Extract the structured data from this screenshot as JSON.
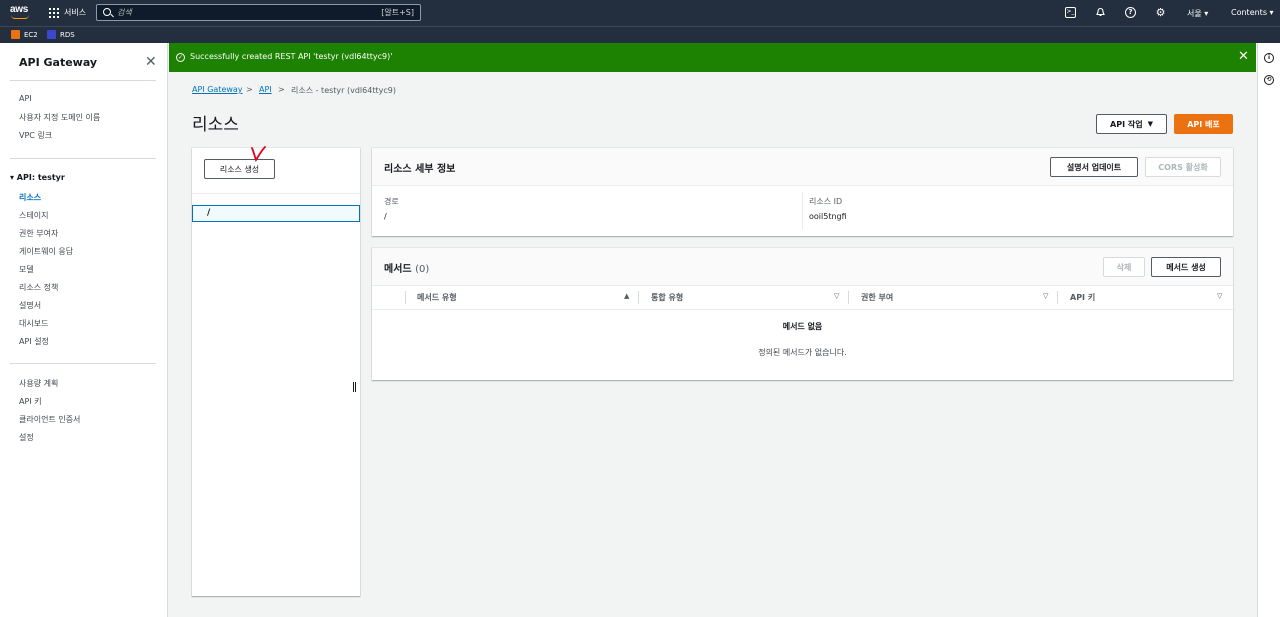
{
  "topnav": {
    "logo": "aws",
    "services_label": "서비스",
    "search_placeholder": "검색",
    "search_shortcut": "[알트+S]",
    "region": "서울 ▾",
    "account": "Contents ▾",
    "icons": [
      "terminal-icon",
      "bell-icon",
      "help-icon",
      "gear-icon"
    ]
  },
  "favorites": [
    {
      "label": "EC2",
      "color": "#ec7211",
      "icon": "ec2-icon"
    },
    {
      "label": "RDS",
      "color": "#3b48cc",
      "icon": "rds-icon"
    }
  ],
  "sidebar": {
    "title": "API Gateway",
    "top_items": [
      "API",
      "사용자 지정 도메인 이름",
      "VPC 링크"
    ],
    "api_section": "▾ API: testyr",
    "api_items": [
      "리소스",
      "스테이지",
      "권한 부여자",
      "게이트웨이 응답",
      "모델",
      "리소스 정책",
      "설명서",
      "대시보드",
      "API 설정"
    ],
    "active_item": "리소스",
    "bottom_items": [
      "사용량 계획",
      "API 키",
      "클라이언트 인증서",
      "설정"
    ]
  },
  "flash": {
    "message": "Successfully created REST API 'testyr (vdl64ttyc9)'",
    "color": "#1d8102"
  },
  "breadcrumb": {
    "items": [
      "API Gateway",
      "API",
      "리소스 - testyr (vdl64ttyc9)"
    ],
    "separator": ">"
  },
  "page": {
    "title": "리소스",
    "actions_button": "API 작업",
    "deploy_button": "API 배포",
    "accent": "#ec7211"
  },
  "tree": {
    "create_button": "리소스 생성",
    "root": "/",
    "annotation": "V"
  },
  "details": {
    "title": "리소스 세부 정보",
    "update_doc_button": "설명서 업데이트",
    "cors_button": "CORS 활성화",
    "path_label": "경로",
    "path_value": "/",
    "id_label": "리소스 ID",
    "id_value": "ooil5tngfi"
  },
  "methods": {
    "title": "메서드",
    "count": "(0)",
    "delete_button": "삭제",
    "create_button": "메서드 생성",
    "columns": [
      "메서드 유형",
      "통합 유형",
      "권한 부여",
      "API 키"
    ],
    "empty_title": "메서드 없음",
    "empty_sub": "정의된 메서드가 없습니다."
  }
}
